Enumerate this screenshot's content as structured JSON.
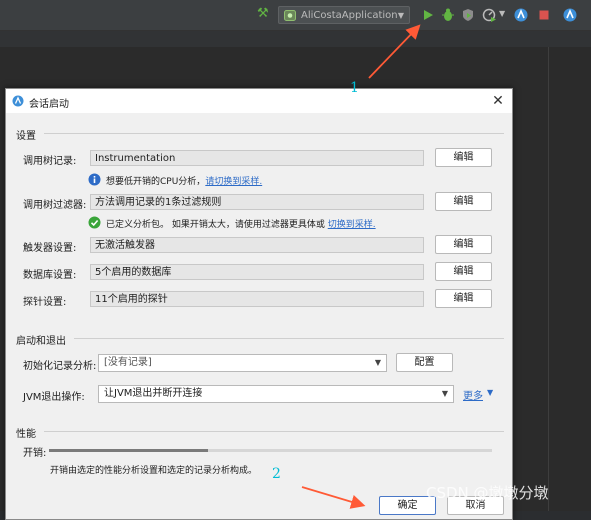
{
  "toolbar": {
    "run_configuration": "AliCostaApplication"
  },
  "annotations": {
    "step1": "1",
    "step2": "2"
  },
  "dialog": {
    "title": "会话启动",
    "settings": {
      "section_label": "设置",
      "rows": [
        {
          "label": "调用树记录:",
          "value": "Instrumentation",
          "button": "编辑"
        },
        {
          "label": "调用树过滤器:",
          "value": "方法调用记录的1条过滤规则",
          "button": "编辑"
        },
        {
          "label": "触发器设置:",
          "value": "无激活触发器",
          "button": "编辑"
        },
        {
          "label": "数据库设置:",
          "value": "5个启用的数据库",
          "button": "编辑"
        },
        {
          "label": "探针设置:",
          "value": "11个启用的探针",
          "button": "编辑"
        }
      ],
      "info_recording": {
        "text": "想要低开销的CPU分析，",
        "link": "请切换到采样."
      },
      "info_filter": {
        "text": "已定义分析包。 如果开销太大，请使用过滤器更具体或 ",
        "link": "切换到采样."
      }
    },
    "startup_exit": {
      "section_label": "启动和退出",
      "init_label": "初始化记录分析:",
      "init_value": "[没有记录]",
      "configure_button": "配置",
      "jvm_exit_label": "JVM退出操作:",
      "jvm_exit_value": "让JVM退出并断开连接",
      "more_link": "更多"
    },
    "performance": {
      "section_label": "性能",
      "overhead_label": "开销:",
      "overhead_fraction": 0.36,
      "note": "开销由选定的性能分析设置和选定的记录分析构成。"
    },
    "footer": {
      "ok_button": "确定",
      "cancel_button": "取消"
    }
  },
  "watermark": "CSDN @墩墩分墩",
  "colors": {
    "link": "#2d6bc7",
    "annotation": "#00bcd4",
    "arrow": "#ff5a36",
    "run_green": "#62b543",
    "stop_red": "#d9534f"
  }
}
